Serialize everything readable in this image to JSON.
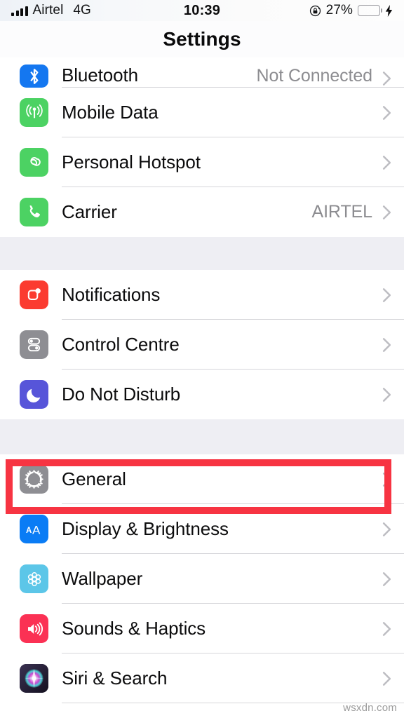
{
  "status_bar": {
    "carrier": "Airtel",
    "network": "4G",
    "time": "10:39",
    "battery_percent": "27%",
    "battery_level": 27,
    "signal_bars": 4,
    "icons": [
      "signal-bars-icon",
      "rotation-lock-icon",
      "battery-icon",
      "charging-bolt-icon"
    ]
  },
  "nav": {
    "title": "Settings"
  },
  "groups": [
    {
      "id": "connectivity",
      "rows": [
        {
          "label": "Bluetooth",
          "detail": "Not Connected",
          "icon": "bluetooth-icon",
          "icon_color": "#1477f0",
          "clipped": true
        },
        {
          "label": "Mobile Data",
          "detail": "",
          "icon": "mobile-data-icon",
          "icon_color": "#4cd263",
          "clipped": false
        },
        {
          "label": "Personal Hotspot",
          "detail": "",
          "icon": "personal-hotspot-icon",
          "icon_color": "#4cd263",
          "clipped": false
        },
        {
          "label": "Carrier",
          "detail": "AIRTEL",
          "icon": "carrier-phone-icon",
          "icon_color": "#4cd263",
          "clipped": false
        }
      ]
    },
    {
      "id": "alerts",
      "rows": [
        {
          "label": "Notifications",
          "detail": "",
          "icon": "notifications-icon",
          "icon_color": "#fb3b30",
          "clipped": false
        },
        {
          "label": "Control Centre",
          "detail": "",
          "icon": "control-centre-icon",
          "icon_color": "#8e8e93",
          "clipped": false
        },
        {
          "label": "Do Not Disturb",
          "detail": "",
          "icon": "do-not-disturb-icon",
          "icon_color": "#5755d9",
          "clipped": false
        }
      ]
    },
    {
      "id": "system",
      "rows": [
        {
          "label": "General",
          "detail": "",
          "icon": "general-gear-icon",
          "icon_color": "#8e8e93",
          "clipped": false,
          "highlighted": true
        },
        {
          "label": "Display & Brightness",
          "detail": "",
          "icon": "display-brightness-icon",
          "icon_color": "#0a7cf5",
          "clipped": false
        },
        {
          "label": "Wallpaper",
          "detail": "",
          "icon": "wallpaper-icon",
          "icon_color": "#5cc6e8",
          "clipped": false
        },
        {
          "label": "Sounds & Haptics",
          "detail": "",
          "icon": "sounds-haptics-icon",
          "icon_color": "#fb3154",
          "clipped": false
        },
        {
          "label": "Siri & Search",
          "detail": "",
          "icon": "siri-search-icon",
          "icon_color": "#2b2440",
          "clipped": false
        }
      ]
    }
  ],
  "highlight": {
    "target": "General",
    "color": "#f73442"
  },
  "watermark": "wsxdn.com"
}
